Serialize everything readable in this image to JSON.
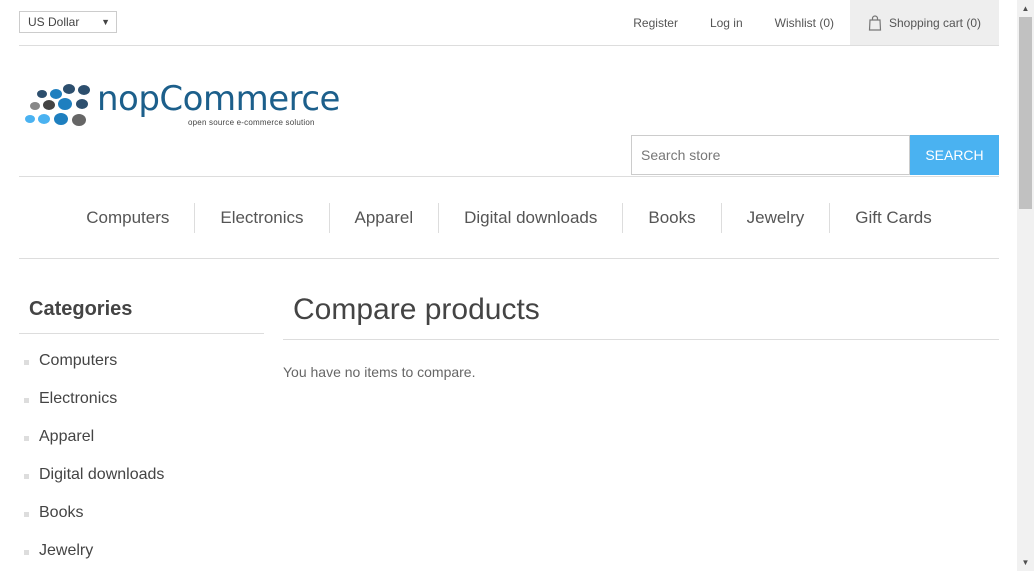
{
  "header": {
    "currency": "US Dollar",
    "links": {
      "register": "Register",
      "login": "Log in",
      "wishlist": "Wishlist (0)",
      "cart": "Shopping cart (0)"
    }
  },
  "logo": {
    "name": "nopCommerce",
    "tagline": "open source e-commerce solution"
  },
  "search": {
    "placeholder": "Search store",
    "button": "SEARCH"
  },
  "menu": [
    "Computers",
    "Electronics",
    "Apparel",
    "Digital downloads",
    "Books",
    "Jewelry",
    "Gift Cards"
  ],
  "sidebar": {
    "title": "Categories",
    "items": [
      "Computers",
      "Electronics",
      "Apparel",
      "Digital downloads",
      "Books",
      "Jewelry"
    ]
  },
  "main": {
    "title": "Compare products",
    "message": "You have no items to compare."
  },
  "colors": {
    "accent": "#4ab2f1",
    "logo": "#1c5f8b"
  }
}
